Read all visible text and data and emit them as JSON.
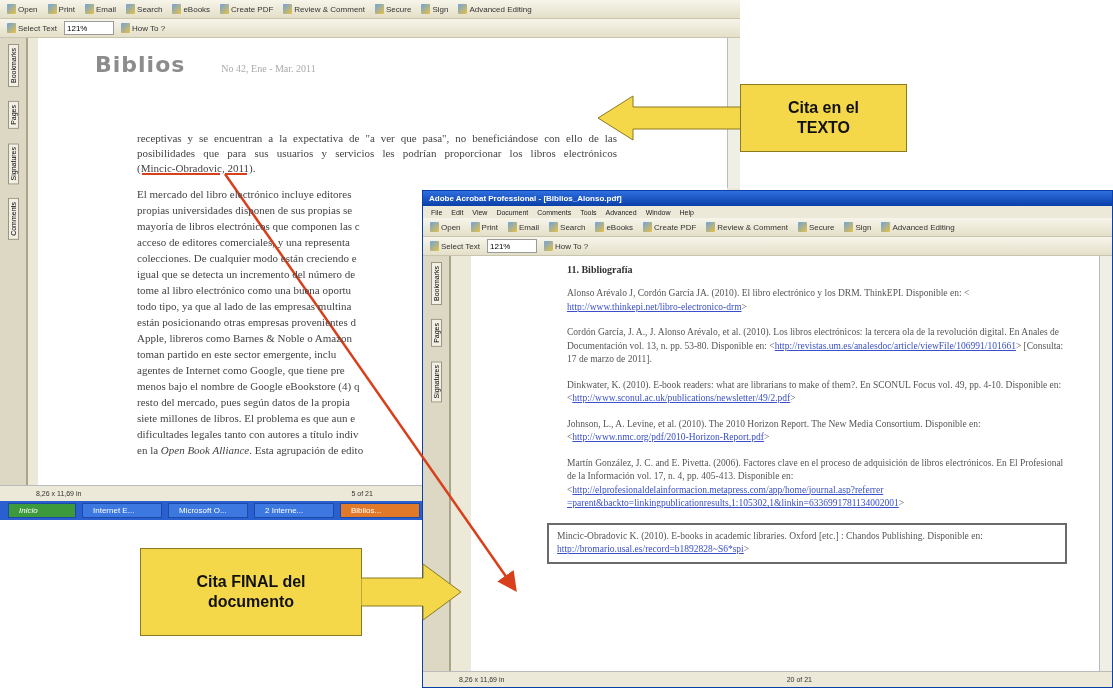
{
  "back_window": {
    "toolbar_1": [
      "Open",
      "Print",
      "Email",
      "Search",
      "eBooks",
      "Create PDF",
      "Review & Comment",
      "Secure",
      "Sign",
      "Advanced Editing"
    ],
    "toolbar_2": [
      "Select Text",
      "How To ?"
    ],
    "zoom": "121%",
    "side_tabs": [
      "Bookmarks",
      "Pages",
      "Signatures",
      "Comments"
    ],
    "logo": "Biblios",
    "issue": "No 42, Ene - Mar. 2011",
    "paragraph_1": {
      "before": "receptivas y se encuentran a la expectativa de \"a ver que pasa\", no beneficiándose con ello de las posibilidades que para sus usuarios y servicios les podrían proporcionar los libros electrónicos ",
      "citation": "(Mincic-Obradovic, 2011)",
      "after": "."
    },
    "paragraph_2": [
      "El mercado del libro electrónico incluye editores",
      "propias universidades disponen de sus propias se",
      "mayoría de libros electrónicos que componen las c",
      "acceso de editores comerciales, y una representa",
      "colecciones. De cualquier modo están creciendo e",
      "igual que se detecta un incremento del número de",
      "tome al libro electrónico como una buena oportu",
      "todo tipo, ya que al lado de las empresas multina",
      "están posicionando otras empresas provenientes d",
      "Apple, libreros como Barnes & Noble o Amazon",
      "toman partido en este sector emergente, inclu",
      "agentes de Internet como Google, que tiene pre",
      "menos bajo el nombre de Google eBookstore (4) q",
      "resto del mercado, pues según datos de la propia",
      "siete millones de libros. El problema es que aun e",
      "dificultades legales tanto con autores a título indiv",
      "en la *Open Book Alliance*. Esta agrupación de edito"
    ],
    "page_size": "8,26 x 11,69 in",
    "page": "5 of 21",
    "taskbar": [
      {
        "label": "Inicio",
        "kind": "start",
        "selected": false
      },
      {
        "label": "Internet E...",
        "kind": "task",
        "selected": false
      },
      {
        "label": "Microsoft O...",
        "kind": "task",
        "selected": false
      },
      {
        "label": "2 Interne...",
        "kind": "task",
        "selected": false
      },
      {
        "label": "Biblios...",
        "kind": "task",
        "selected": true
      }
    ]
  },
  "front_window": {
    "title": "Adobe Acrobat Professional - [Biblios_Alonso.pdf]",
    "menu": [
      "File",
      "Edit",
      "View",
      "Document",
      "Comments",
      "Tools",
      "Advanced",
      "Window",
      "Help"
    ],
    "toolbar_1": [
      "Open",
      "Print",
      "Email",
      "Search",
      "eBooks",
      "Create PDF",
      "Review & Comment",
      "Secure",
      "Sign",
      "Advanced Editing"
    ],
    "toolbar_2": [
      "Select Text",
      "How To ?"
    ],
    "zoom": "121%",
    "side_tabs": [
      "Bookmarks",
      "Pages",
      "Signatures"
    ],
    "heading": "11. Bibliografía",
    "references": [
      {
        "text": "Alonso Arévalo J, Cordón García JA. (2010). El libro electrónico y los DRM. ThinkEPI. Disponible en: < ",
        "links": [
          "http://www.thinkepi.net/libro-electronico-drm"
        ],
        "after": ">",
        "highlighted": false
      },
      {
        "text": "Cordón García, J. A., J. Alonso Arévalo, et al. (2010). Los libros electrónicos: la tercera ola de la revolución digital. En Anales de Documentación vol. 13, n. pp. 53-80. Disponible en: <",
        "links": [
          "http://revistas.um.es/analesdoc/article/viewFile/106991/101661"
        ],
        "after": "> [Consulta: 17 de marzo de 2011].",
        "highlighted": false
      },
      {
        "text": "Dinkwater, K. (2010). E-book readers: what are librarians to make of them?. En SCONUL Focus vol. 49, pp. 4-10. Disponible en: <",
        "links": [
          "http://www.sconul.ac.uk/publications/newsletter/49/2.pdf"
        ],
        "after": ">",
        "highlighted": false
      },
      {
        "text": "Johnson, L., A. Levine, et al. (2010). The 2010 Horizon Report. The New Media Consortium. Disponible en: <",
        "links": [
          "http://www.nmc.org/pdf/2010-Horizon-Report.pdf"
        ],
        "after": ">",
        "highlighted": false
      },
      {
        "text": "Martín González, J. C. and E. Pivetta. (2006). Factores clave en el proceso de adquisición de libros electrónicos. En El Profesional de la Información vol. 17, n. 4, pp. 405-413. Disponible en: <",
        "links": [
          "http://elprofesionaldelainformacion.metapress.com/app/home/journal.asp?referrer",
          "=parent&backto=linkingpublicationresults,1:105302,1&linkin=6336991781134002001"
        ],
        "after": ">",
        "highlighted": false
      },
      {
        "text": "Mincic-Obradovic K. (2010). E-books in academic libraries. Oxford [etc.] : Chandos Publishing. Disponible en: ",
        "links": [
          "http://bromario.usal.es/record=b1892828~S6*spi"
        ],
        "after": ">",
        "highlighted": true
      }
    ],
    "page_size": "8,26 x 11,69 in",
    "page": "20 of 21"
  },
  "callouts": [
    {
      "lines": [
        "Cita en el",
        "TEXTO"
      ],
      "kind": "left"
    },
    {
      "lines": [
        "Cita FINAL del",
        "documento"
      ],
      "kind": "right"
    }
  ]
}
